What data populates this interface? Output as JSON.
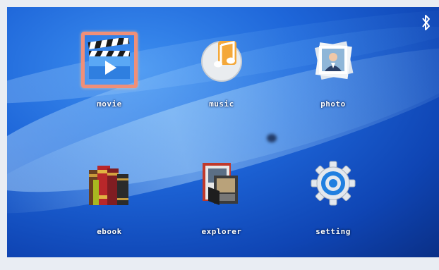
{
  "menu": {
    "items": [
      {
        "label": "movie",
        "icon": "movie-clapper-icon",
        "selected": true
      },
      {
        "label": "music",
        "icon": "music-note-icon",
        "selected": false
      },
      {
        "label": "photo",
        "icon": "photo-frames-icon",
        "selected": false
      },
      {
        "label": "ebook",
        "icon": "books-icon",
        "selected": false
      },
      {
        "label": "explorer",
        "icon": "file-explorer-icon",
        "selected": false
      },
      {
        "label": "setting",
        "icon": "gear-icon",
        "selected": false
      }
    ]
  },
  "status": {
    "bluetooth_icon": "bluetooth-icon"
  },
  "colors": {
    "selection_border": "#f08f78",
    "background": "#1e66d9"
  }
}
